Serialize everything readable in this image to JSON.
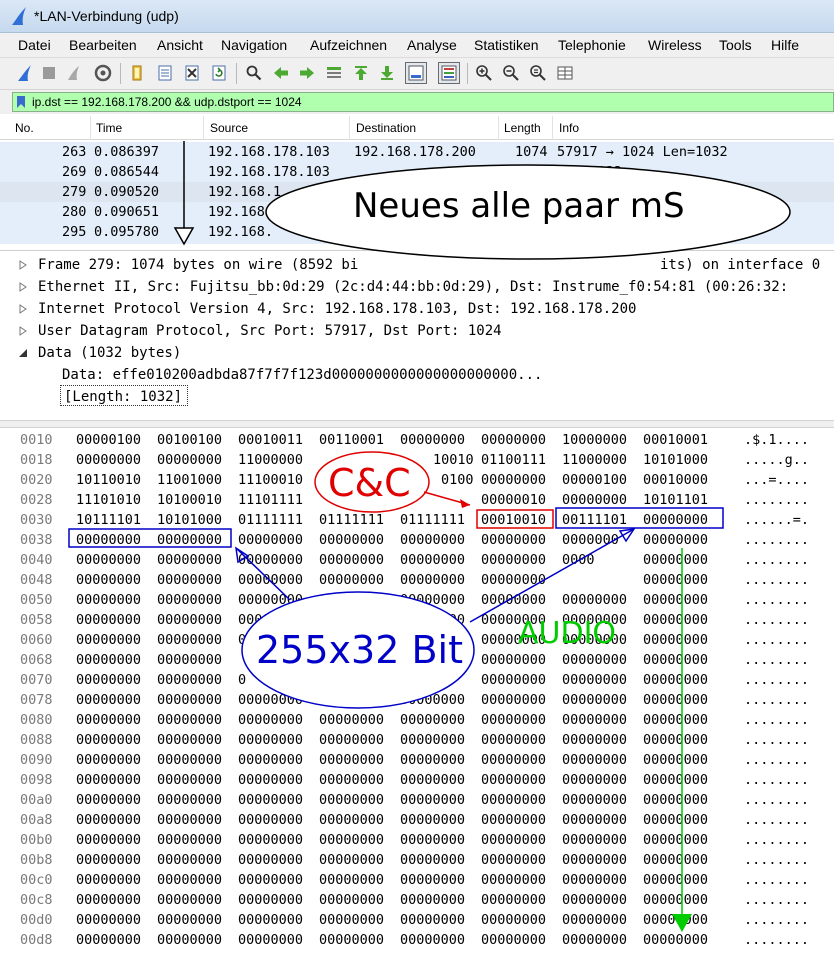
{
  "window": {
    "title": "*LAN-Verbindung (udp)"
  },
  "menu": [
    "Datei",
    "Bearbeiten",
    "Ansicht",
    "Navigation",
    "Aufzeichnen",
    "Analyse",
    "Statistiken",
    "Telephonie",
    "Wireless",
    "Tools",
    "Hilfe"
  ],
  "toolbar": {
    "icons": [
      "shark-fin-start-icon",
      "stop-icon",
      "restart-icon",
      "capture-options-icon",
      "open-file-icon",
      "save-file-icon",
      "close-file-icon",
      "reload-icon",
      "find-packet-icon",
      "go-back-icon",
      "go-forward-icon",
      "go-to-packet-icon",
      "first-packet-icon",
      "last-packet-icon",
      "autoscroll-icon",
      "colorize-icon",
      "zoom-in-icon",
      "zoom-out-icon",
      "normal-size-icon",
      "resize-columns-icon"
    ]
  },
  "filter": {
    "text": "ip.dst == 192.168.178.200 && udp.dstport == 1024"
  },
  "packet_list": {
    "columns": [
      "No.",
      "Time",
      "Source",
      "Destination",
      "Length",
      "Info"
    ],
    "rows": [
      {
        "no": "263",
        "time": "0.086397",
        "src": "192.168.178.103",
        "dst": "192.168.178.200",
        "len": "1074",
        "info": "57917 → 1024 Len=1032"
      },
      {
        "no": "269",
        "time": "0.086544",
        "src": "192.168.178.103",
        "dst": "",
        "len": "",
        "info": "Len=1032"
      },
      {
        "no": "279",
        "time": "0.090520",
        "src": "192.168.1",
        "dst": "",
        "len": "",
        "info": ""
      },
      {
        "no": "280",
        "time": "0.090651",
        "src": "192.168",
        "dst": "",
        "len": "",
        "info": ""
      },
      {
        "no": "295",
        "time": "0.095780",
        "src": "192.168.",
        "dst": "",
        "len": "",
        "info": ""
      }
    ]
  },
  "details": {
    "rows": [
      {
        "text": "Frame 279: 1074 bytes on wire (8592 bi",
        "tail": "its) on interface 0",
        "expanded": false
      },
      {
        "text": "Ethernet II, Src: Fujitsu_bb:0d:29 (2c:d4:44:bb:0d:29), Dst: Instrume_f0:54:81 (00:26:32:",
        "tail": "",
        "expanded": false
      },
      {
        "text": "Internet Protocol Version 4, Src: 192.168.178.103, Dst: 192.168.178.200",
        "tail": "",
        "expanded": false
      },
      {
        "text": "User Datagram Protocol, Src Port: 57917, Dst Port: 1024",
        "tail": "",
        "expanded": false
      },
      {
        "text": "Data (1032 bytes)",
        "tail": "",
        "expanded": true
      }
    ],
    "data_line": "Data: effe010200adbda87f7f7f123d0000000000000000000000...",
    "length_line": "[Length: 1032]"
  },
  "hex": {
    "rows": [
      {
        "off": "0010",
        "bytes": [
          "00000100",
          "00100100",
          "00010011",
          "00110001",
          "00000000",
          "00000000",
          "10000000",
          "00010001"
        ],
        "ascii": ".$.1...."
      },
      {
        "off": "0018",
        "bytes": [
          "00000000",
          "00000000",
          "11000000",
          "",
          "10010",
          "01100111",
          "11000000",
          "10101000"
        ],
        "ascii": ".....g.."
      },
      {
        "off": "0020",
        "bytes": [
          "10110010",
          "11001000",
          "11100010",
          "",
          "0100",
          "00000000",
          "00000100",
          "00010000"
        ],
        "ascii": "...=...."
      },
      {
        "off": "0028",
        "bytes": [
          "11101010",
          "10100010",
          "11101111",
          "",
          "",
          "00000010",
          "00000000",
          "10101101"
        ],
        "ascii": "........"
      },
      {
        "off": "0030",
        "bytes": [
          "10111101",
          "10101000",
          "01111111",
          "01111111",
          "01111111",
          "00010010",
          "00111101",
          "00000000"
        ],
        "ascii": "......=."
      },
      {
        "off": "0038",
        "bytes": [
          "00000000",
          "00000000",
          "00000000",
          "00000000",
          "00000000",
          "00000000",
          "0000000",
          "00000000"
        ],
        "ascii": "........"
      },
      {
        "off": "0040",
        "bytes": [
          "00000000",
          "00000000",
          "00000000",
          "00000000",
          "00000000",
          "00000000",
          "0000",
          "00000000"
        ],
        "ascii": "........"
      },
      {
        "off": "0048",
        "bytes": [
          "00000000",
          "00000000",
          "00000000",
          "00000000",
          "00000000",
          "00000000",
          "",
          "00000000"
        ],
        "ascii": "........"
      },
      {
        "off": "0050",
        "bytes": [
          "00000000",
          "00000000",
          "00000000",
          "00000000",
          "00000000",
          "00000000",
          "00000000",
          "00000000"
        ],
        "ascii": "........"
      },
      {
        "off": "0058",
        "bytes": [
          "00000000",
          "00000000",
          "00000000",
          "00000000",
          "00000000",
          "00000000",
          "00000000",
          "00000000"
        ],
        "ascii": "........"
      },
      {
        "off": "0060",
        "bytes": [
          "00000000",
          "00000000",
          "0",
          "",
          "",
          "00000000",
          "00000000",
          "00000000"
        ],
        "ascii": "........"
      },
      {
        "off": "0068",
        "bytes": [
          "00000000",
          "00000000",
          "",
          "",
          "",
          "00000000",
          "00000000",
          "00000000"
        ],
        "ascii": "........"
      },
      {
        "off": "0070",
        "bytes": [
          "00000000",
          "00000000",
          "0",
          "",
          "",
          "00000000",
          "00000000",
          "00000000"
        ],
        "ascii": "........"
      },
      {
        "off": "0078",
        "bytes": [
          "00000000",
          "00000000",
          "00000000",
          "00000000",
          "00000000",
          "00000000",
          "00000000",
          "00000000"
        ],
        "ascii": "........"
      },
      {
        "off": "0080",
        "bytes": [
          "00000000",
          "00000000",
          "00000000",
          "00000000",
          "00000000",
          "00000000",
          "00000000",
          "00000000"
        ],
        "ascii": "........"
      },
      {
        "off": "0088",
        "bytes": [
          "00000000",
          "00000000",
          "00000000",
          "00000000",
          "00000000",
          "00000000",
          "00000000",
          "00000000"
        ],
        "ascii": "........"
      },
      {
        "off": "0090",
        "bytes": [
          "00000000",
          "00000000",
          "00000000",
          "00000000",
          "00000000",
          "00000000",
          "00000000",
          "00000000"
        ],
        "ascii": "........"
      },
      {
        "off": "0098",
        "bytes": [
          "00000000",
          "00000000",
          "00000000",
          "00000000",
          "00000000",
          "00000000",
          "00000000",
          "00000000"
        ],
        "ascii": "........"
      },
      {
        "off": "00a0",
        "bytes": [
          "00000000",
          "00000000",
          "00000000",
          "00000000",
          "00000000",
          "00000000",
          "00000000",
          "00000000"
        ],
        "ascii": "........"
      },
      {
        "off": "00a8",
        "bytes": [
          "00000000",
          "00000000",
          "00000000",
          "00000000",
          "00000000",
          "00000000",
          "00000000",
          "00000000"
        ],
        "ascii": "........"
      },
      {
        "off": "00b0",
        "bytes": [
          "00000000",
          "00000000",
          "00000000",
          "00000000",
          "00000000",
          "00000000",
          "00000000",
          "00000000"
        ],
        "ascii": "........"
      },
      {
        "off": "00b8",
        "bytes": [
          "00000000",
          "00000000",
          "00000000",
          "00000000",
          "00000000",
          "00000000",
          "00000000",
          "00000000"
        ],
        "ascii": "........"
      },
      {
        "off": "00c0",
        "bytes": [
          "00000000",
          "00000000",
          "00000000",
          "00000000",
          "00000000",
          "00000000",
          "00000000",
          "00000000"
        ],
        "ascii": "........"
      },
      {
        "off": "00c8",
        "bytes": [
          "00000000",
          "00000000",
          "00000000",
          "00000000",
          "00000000",
          "00000000",
          "00000000",
          "00000000"
        ],
        "ascii": "........"
      },
      {
        "off": "00d0",
        "bytes": [
          "00000000",
          "00000000",
          "00000000",
          "00000000",
          "00000000",
          "00000000",
          "00000000",
          "00000000"
        ],
        "ascii": "........"
      },
      {
        "off": "00d8",
        "bytes": [
          "00000000",
          "00000000",
          "00000000",
          "00000000",
          "00000000",
          "00000000",
          "00000000",
          "00000000"
        ],
        "ascii": "........"
      }
    ]
  },
  "annotations": {
    "neues": "Neues alle paar mS",
    "cc": "C&C",
    "bits": "255x32 Bit",
    "audio": "AUDIO",
    "colors": {
      "red": "#e00000",
      "blue": "#0000c8",
      "green": "#00cc00"
    }
  },
  "colors": {
    "row_selected": "#dde6f0",
    "row_normal": "#e4eefa",
    "filter_bg": "#afffaf"
  }
}
